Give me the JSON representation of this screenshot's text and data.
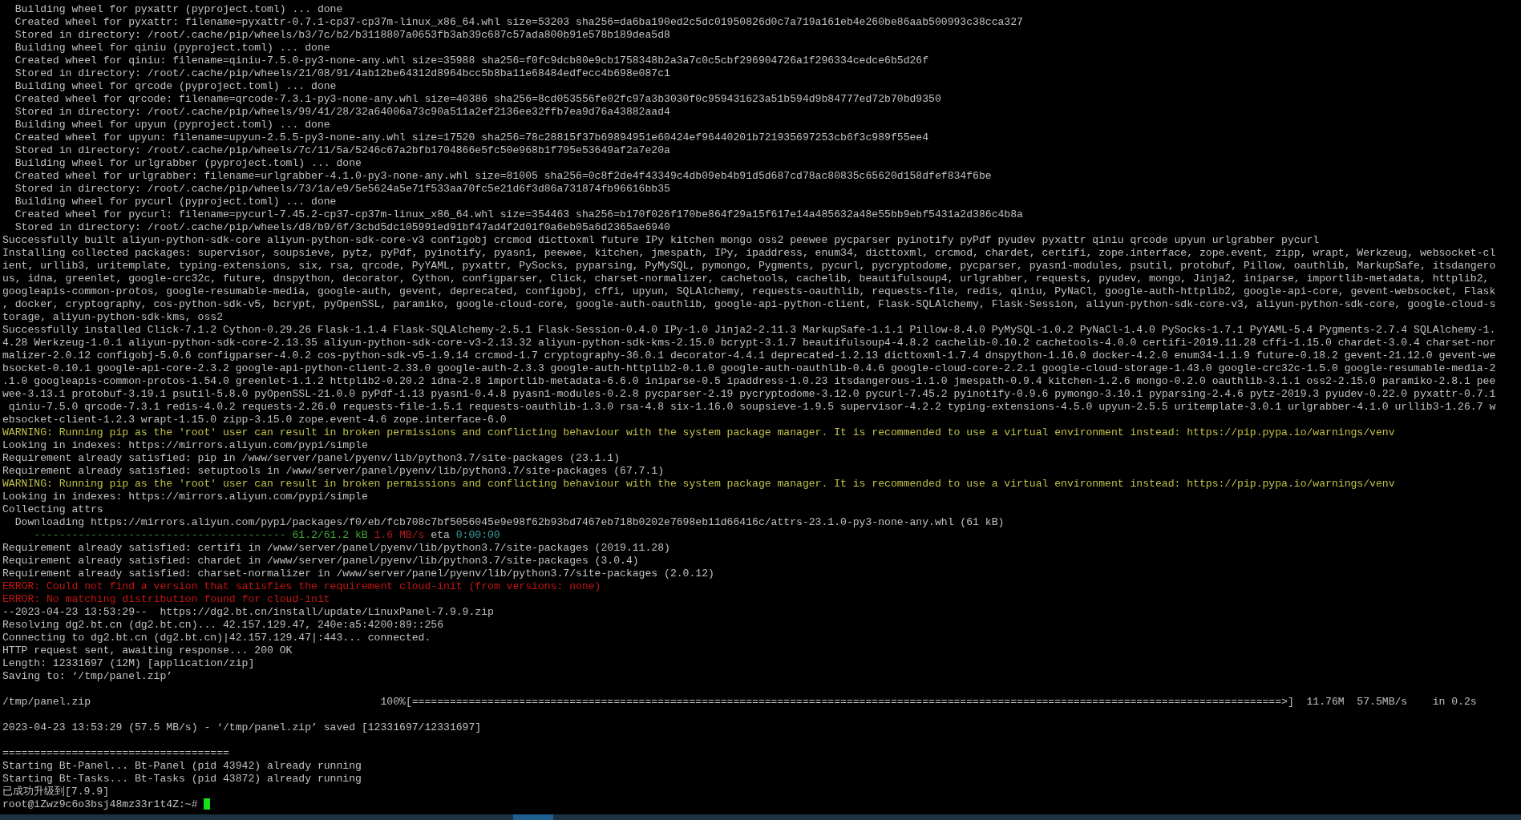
{
  "terminal": {
    "lines": [
      {
        "kind": "plain",
        "text": "  Building wheel for pyxattr (pyproject.toml) ... done"
      },
      {
        "kind": "plain",
        "text": "  Created wheel for pyxattr: filename=pyxattr-0.7.1-cp37-cp37m-linux_x86_64.whl size=53203 sha256=da6ba190ed2c5dc01950826d0c7a719a161eb4e260be86aab500993c38cca327"
      },
      {
        "kind": "plain",
        "text": "  Stored in directory: /root/.cache/pip/wheels/b3/7c/b2/b3118807a0653fb3ab39c687c57ada800b91e578b189dea5d8"
      },
      {
        "kind": "plain",
        "text": "  Building wheel for qiniu (pyproject.toml) ... done"
      },
      {
        "kind": "plain",
        "text": "  Created wheel for qiniu: filename=qiniu-7.5.0-py3-none-any.whl size=35988 sha256=f0fc9dcb80e9cb1758348b2a3a7c0c5cbf296904726a1f296334cedce6b5d26f"
      },
      {
        "kind": "plain",
        "text": "  Stored in directory: /root/.cache/pip/wheels/21/08/91/4ab12be64312d8964bcc5b8ba11e68484edfecc4b698e087c1"
      },
      {
        "kind": "plain",
        "text": "  Building wheel for qrcode (pyproject.toml) ... done"
      },
      {
        "kind": "plain",
        "text": "  Created wheel for qrcode: filename=qrcode-7.3.1-py3-none-any.whl size=40386 sha256=8cd053556fe02fc97a3b3030f0c959431623a51b594d9b84777ed72b70bd9350"
      },
      {
        "kind": "plain",
        "text": "  Stored in directory: /root/.cache/pip/wheels/99/41/28/32a64006a73c90a511a2ef2136ee32ffb7ea9d76a43882aad4"
      },
      {
        "kind": "plain",
        "text": "  Building wheel for upyun (pyproject.toml) ... done"
      },
      {
        "kind": "plain",
        "text": "  Created wheel for upyun: filename=upyun-2.5.5-py3-none-any.whl size=17520 sha256=78c28815f37b69894951e60424ef96440201b721935697253cb6f3c989f55ee4"
      },
      {
        "kind": "plain",
        "text": "  Stored in directory: /root/.cache/pip/wheels/7c/11/5a/5246c67a2bfb1704866e5fc50e968b1f795e53649af2a7e20a"
      },
      {
        "kind": "plain",
        "text": "  Building wheel for urlgrabber (pyproject.toml) ... done"
      },
      {
        "kind": "plain",
        "text": "  Created wheel for urlgrabber: filename=urlgrabber-4.1.0-py3-none-any.whl size=81005 sha256=0c8f2de4f43349c4db09eb4b91d5d687cd78ac80835c65620d158dfef834f6be"
      },
      {
        "kind": "plain",
        "text": "  Stored in directory: /root/.cache/pip/wheels/73/1a/e9/5e5624a5e71f533aa70fc5e21d6f3d86a731874fb96616bb35"
      },
      {
        "kind": "plain",
        "text": "  Building wheel for pycurl (pyproject.toml) ... done"
      },
      {
        "kind": "plain",
        "text": "  Created wheel for pycurl: filename=pycurl-7.45.2-cp37-cp37m-linux_x86_64.whl size=354463 sha256=b170f026f170be864f29a15f617e14a485632a48e55bb9ebf5431a2d386c4b8a"
      },
      {
        "kind": "plain",
        "text": "  Stored in directory: /root/.cache/pip/wheels/d8/b9/6f/3cbd5dc105991ed91bf47ad4f2d01f0a6eb05a6d2365ae6940"
      },
      {
        "kind": "plain",
        "text": "Successfully built aliyun-python-sdk-core aliyun-python-sdk-core-v3 configobj crcmod dicttoxml future IPy kitchen mongo oss2 peewee pycparser pyinotify pyPdf pyudev pyxattr qiniu qrcode upyun urlgrabber pycurl"
      },
      {
        "kind": "plain",
        "text": "Installing collected packages: supervisor, soupsieve, pytz, pyPdf, pyinotify, pyasn1, peewee, kitchen, jmespath, IPy, ipaddress, enum34, dicttoxml, crcmod, chardet, certifi, zope.interface, zope.event, zipp, wrapt, Werkzeug, websocket-cl"
      },
      {
        "kind": "plain",
        "text": "ient, urllib3, uritemplate, typing-extensions, six, rsa, qrcode, PyYAML, pyxattr, PySocks, pyparsing, PyMySQL, pymongo, Pygments, pycurl, pycryptodome, pycparser, pyasn1-modules, psutil, protobuf, Pillow, oauthlib, MarkupSafe, itsdangero"
      },
      {
        "kind": "plain",
        "text": "us, idna, greenlet, google-crc32c, future, dnspython, decorator, Cython, configparser, Click, charset-normalizer, cachetools, cachelib, beautifulsoup4, urlgrabber, requests, pyudev, mongo, Jinja2, iniparse, importlib-metadata, httplib2,"
      },
      {
        "kind": "plain",
        "text": "googleapis-common-protos, google-resumable-media, google-auth, gevent, deprecated, configobj, cffi, upyun, SQLAlchemy, requests-oauthlib, requests-file, redis, qiniu, PyNaCl, google-auth-httplib2, google-api-core, gevent-websocket, Flask"
      },
      {
        "kind": "plain",
        "text": ", docker, cryptography, cos-python-sdk-v5, bcrypt, pyOpenSSL, paramiko, google-cloud-core, google-auth-oauthlib, google-api-python-client, Flask-SQLAlchemy, Flask-Session, aliyun-python-sdk-core-v3, aliyun-python-sdk-core, google-cloud-s"
      },
      {
        "kind": "plain",
        "text": "torage, aliyun-python-sdk-kms, oss2"
      },
      {
        "kind": "plain",
        "text": "Successfully installed Click-7.1.2 Cython-0.29.26 Flask-1.1.4 Flask-SQLAlchemy-2.5.1 Flask-Session-0.4.0 IPy-1.0 Jinja2-2.11.3 MarkupSafe-1.1.1 Pillow-8.4.0 PyMySQL-1.0.2 PyNaCl-1.4.0 PySocks-1.7.1 PyYAML-5.4 Pygments-2.7.4 SQLAlchemy-1."
      },
      {
        "kind": "plain",
        "text": "4.28 Werkzeug-1.0.1 aliyun-python-sdk-core-2.13.35 aliyun-python-sdk-core-v3-2.13.32 aliyun-python-sdk-kms-2.15.0 bcrypt-3.1.7 beautifulsoup4-4.8.2 cachelib-0.10.2 cachetools-4.0.0 certifi-2019.11.28 cffi-1.15.0 chardet-3.0.4 charset-nor"
      },
      {
        "kind": "plain",
        "text": "malizer-2.0.12 configobj-5.0.6 configparser-4.0.2 cos-python-sdk-v5-1.9.14 crcmod-1.7 cryptography-36.0.1 decorator-4.4.1 deprecated-1.2.13 dicttoxml-1.7.4 dnspython-1.16.0 docker-4.2.0 enum34-1.1.9 future-0.18.2 gevent-21.12.0 gevent-we"
      },
      {
        "kind": "plain",
        "text": "bsocket-0.10.1 google-api-core-2.3.2 google-api-python-client-2.33.0 google-auth-2.3.3 google-auth-httplib2-0.1.0 google-auth-oauthlib-0.4.6 google-cloud-core-2.2.1 google-cloud-storage-1.43.0 google-crc32c-1.5.0 google-resumable-media-2"
      },
      {
        "kind": "plain",
        "text": ".1.0 googleapis-common-protos-1.54.0 greenlet-1.1.2 httplib2-0.20.2 idna-2.8 importlib-metadata-6.6.0 iniparse-0.5 ipaddress-1.0.23 itsdangerous-1.1.0 jmespath-0.9.4 kitchen-1.2.6 mongo-0.2.0 oauthlib-3.1.1 oss2-2.15.0 paramiko-2.8.1 pee"
      },
      {
        "kind": "plain",
        "text": "wee-3.13.1 protobuf-3.19.1 psutil-5.8.0 pyOpenSSL-21.0.0 pyPdf-1.13 pyasn1-0.4.8 pyasn1-modules-0.2.8 pycparser-2.19 pycryptodome-3.12.0 pycurl-7.45.2 pyinotify-0.9.6 pymongo-3.10.1 pyparsing-2.4.6 pytz-2019.3 pyudev-0.22.0 pyxattr-0.7.1"
      },
      {
        "kind": "plain",
        "text": " qiniu-7.5.0 qrcode-7.3.1 redis-4.0.2 requests-2.26.0 requests-file-1.5.1 requests-oauthlib-1.3.0 rsa-4.8 six-1.16.0 soupsieve-1.9.5 supervisor-4.2.2 typing-extensions-4.5.0 upyun-2.5.5 uritemplate-3.0.1 urlgrabber-4.1.0 urllib3-1.26.7 w"
      },
      {
        "kind": "plain",
        "text": "ebsocket-client-1.2.3 wrapt-1.15.0 zipp-3.15.0 zope.event-4.6 zope.interface-6.0"
      },
      {
        "kind": "warning",
        "text": "WARNING: Running pip as the 'root' user can result in broken permissions and conflicting behaviour with the system package manager. It is recommended to use a virtual environment instead: https://pip.pypa.io/warnings/venv"
      },
      {
        "kind": "plain",
        "text": "Looking in indexes: https://mirrors.aliyun.com/pypi/simple"
      },
      {
        "kind": "plain",
        "text": "Requirement already satisfied: pip in /www/server/panel/pyenv/lib/python3.7/site-packages (23.1.1)"
      },
      {
        "kind": "plain",
        "text": "Requirement already satisfied: setuptools in /www/server/panel/pyenv/lib/python3.7/site-packages (67.7.1)"
      },
      {
        "kind": "warning",
        "text": "WARNING: Running pip as the 'root' user can result in broken permissions and conflicting behaviour with the system package manager. It is recommended to use a virtual environment instead: https://pip.pypa.io/warnings/venv"
      },
      {
        "kind": "plain",
        "text": "Looking in indexes: https://mirrors.aliyun.com/pypi/simple"
      },
      {
        "kind": "plain",
        "text": "Collecting attrs"
      },
      {
        "kind": "plain",
        "text": "  Downloading https://mirrors.aliyun.com/pypi/packages/f0/eb/fcb708c7bf5056045e9e98f62b93bd7467eb718b0202e7698eb11d66416c/attrs-23.1.0-py3-none-any.whl (61 kB)"
      },
      {
        "kind": "mixed",
        "segments": [
          {
            "kind": "bar",
            "text": "     ----------------------------------------"
          },
          {
            "kind": "size",
            "text": "61.2/61.2 kB"
          },
          {
            "kind": "rate",
            "text": "1.6 MB/s"
          },
          {
            "kind": "plain",
            "text": "eta"
          },
          {
            "kind": "eta",
            "text": "0:00:00"
          }
        ]
      },
      {
        "kind": "plain",
        "text": "Requirement already satisfied: certifi in /www/server/panel/pyenv/lib/python3.7/site-packages (2019.11.28)"
      },
      {
        "kind": "plain",
        "text": "Requirement already satisfied: chardet in /www/server/panel/pyenv/lib/python3.7/site-packages (3.0.4)"
      },
      {
        "kind": "plain",
        "text": "Requirement already satisfied: charset-normalizer in /www/server/panel/pyenv/lib/python3.7/site-packages (2.0.12)"
      },
      {
        "kind": "error",
        "text": "ERROR: Could not find a version that satisfies the requirement cloud-init (from versions: none)"
      },
      {
        "kind": "error",
        "text": "ERROR: No matching distribution found for cloud-init"
      },
      {
        "kind": "plain",
        "text": "--2023-04-23 13:53:29--  https://dg2.bt.cn/install/update/LinuxPanel-7.9.9.zip"
      },
      {
        "kind": "plain",
        "text": "Resolving dg2.bt.cn (dg2.bt.cn)... 42.157.129.47, 240e:a5:4200:89::256"
      },
      {
        "kind": "plain",
        "text": "Connecting to dg2.bt.cn (dg2.bt.cn)|42.157.129.47|:443... connected."
      },
      {
        "kind": "plain",
        "text": "HTTP request sent, awaiting response... 200 OK"
      },
      {
        "kind": "plain",
        "text": "Length: 12331697 (12M) [application/zip]"
      },
      {
        "kind": "plain",
        "text": "Saving to: ‘/tmp/panel.zip’"
      },
      {
        "kind": "blank"
      },
      {
        "kind": "plain",
        "text": "/tmp/panel.zip                                              100%[==========================================================================================================================================>]  11.76M  57.5MB/s    in 0.2s"
      },
      {
        "kind": "blank"
      },
      {
        "kind": "plain",
        "text": "2023-04-23 13:53:29 (57.5 MB/s) - ‘/tmp/panel.zip’ saved [12331697/12331697]"
      },
      {
        "kind": "blank"
      },
      {
        "kind": "plain",
        "text": "===================================="
      },
      {
        "kind": "plain",
        "text": "Starting Bt-Panel... Bt-Panel (pid 43942) already running"
      },
      {
        "kind": "plain",
        "text": "Starting Bt-Tasks... Bt-Tasks (pid 43872) already running"
      },
      {
        "kind": "plain",
        "text": "已成功升级到[7.9.9]"
      },
      {
        "kind": "mixed",
        "segments": [
          {
            "kind": "prompt",
            "text": "root@iZwz9c6o3bsj48mz33r1t4Z:~#"
          },
          {
            "kind": "cursor"
          }
        ]
      }
    ]
  }
}
